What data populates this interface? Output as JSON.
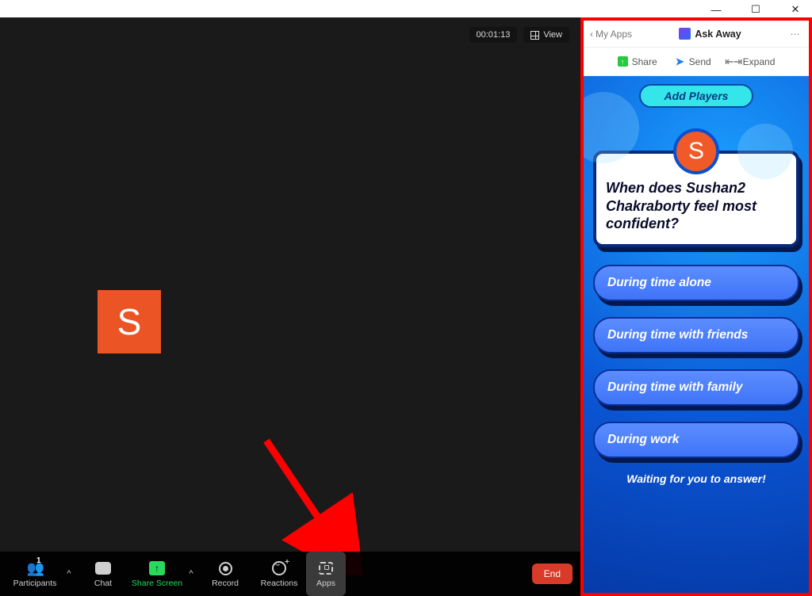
{
  "window": {
    "minimize": "—",
    "maximize": "☐",
    "close": "✕"
  },
  "meeting": {
    "timer": "00:01:13",
    "view_label": "View",
    "avatar_initial": "S",
    "end_label": "End"
  },
  "toolbar": {
    "participants": {
      "label": "Participants",
      "count": "1"
    },
    "chat": {
      "label": "Chat"
    },
    "share": {
      "label": "Share Screen"
    },
    "record": {
      "label": "Record"
    },
    "reactions": {
      "label": "Reactions"
    },
    "apps": {
      "label": "Apps"
    }
  },
  "panel": {
    "back_label": "My Apps",
    "title": "Ask Away",
    "actions": {
      "share": "Share",
      "send": "Send",
      "expand": "Expand"
    }
  },
  "game": {
    "add_players_label": "Add Players",
    "avatar_initial": "S",
    "question": "When does Sushan2 Chakraborty feel most confident?",
    "answers": [
      "During time alone",
      "During time with friends",
      "During time with family",
      "During work"
    ],
    "waiting_message": "Waiting for you to answer!"
  }
}
